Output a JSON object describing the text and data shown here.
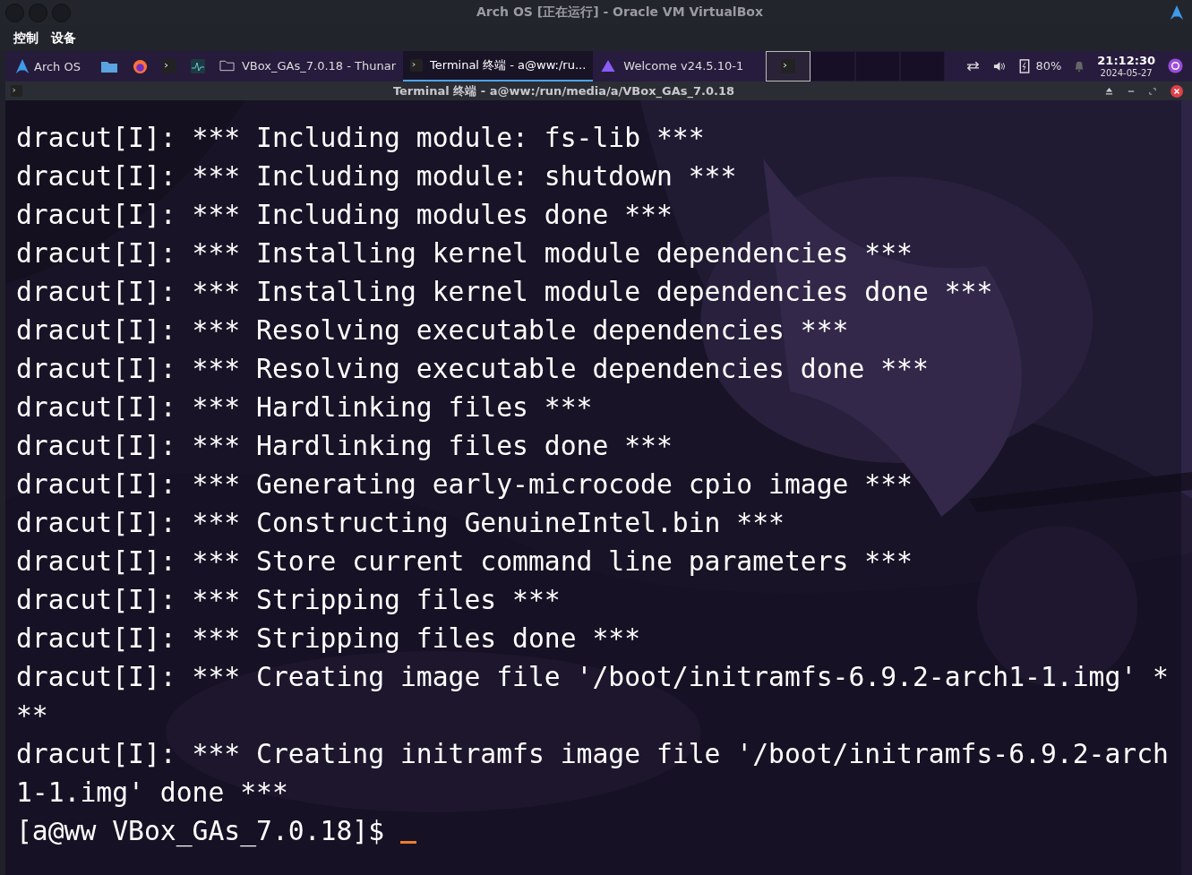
{
  "vbox": {
    "title": "Arch OS [正在运行] - Oracle VM VirtualBox",
    "menu": [
      "控制",
      "设备"
    ]
  },
  "taskbar": {
    "start": "Arch OS",
    "tasks": [
      {
        "label": "VBox_GAs_7.0.18 - Thunar",
        "selected": false
      },
      {
        "label": "Terminal 终端 - a@ww:/ru...",
        "selected": true
      },
      {
        "label": "Welcome v24.5.10-1",
        "selected": false
      }
    ],
    "workspaces": [
      {
        "selected": true
      },
      {
        "selected": false
      },
      {
        "selected": false
      },
      {
        "selected": false
      }
    ],
    "battery": "80%",
    "time": "21:12:30",
    "date": "2024-05-27"
  },
  "terminal": {
    "title": "Terminal 终端 - a@ww:/run/media/a/VBox_GAs_7.0.18",
    "lines": [
      "dracut[I]: *** Including module: fs-lib ***",
      "dracut[I]: *** Including module: shutdown ***",
      "dracut[I]: *** Including modules done ***",
      "dracut[I]: *** Installing kernel module dependencies ***",
      "dracut[I]: *** Installing kernel module dependencies done ***",
      "dracut[I]: *** Resolving executable dependencies ***",
      "dracut[I]: *** Resolving executable dependencies done ***",
      "dracut[I]: *** Hardlinking files ***",
      "dracut[I]: *** Hardlinking files done ***",
      "dracut[I]: *** Generating early-microcode cpio image ***",
      "dracut[I]: *** Constructing GenuineIntel.bin ***",
      "dracut[I]: *** Store current command line parameters ***",
      "dracut[I]: *** Stripping files ***",
      "dracut[I]: *** Stripping files done ***",
      "dracut[I]: *** Creating image file '/boot/initramfs-6.9.2-arch1-1.img' ***",
      "dracut[I]: *** Creating initramfs image file '/boot/initramfs-6.9.2-arch1-1.img' done ***"
    ],
    "prompt": "[a@ww VBox_GAs_7.0.18]$"
  }
}
